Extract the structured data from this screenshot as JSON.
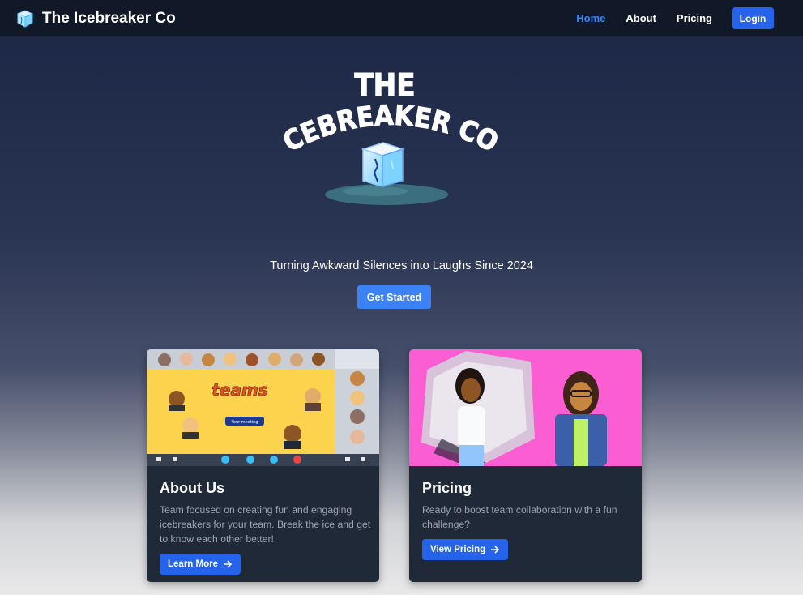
{
  "nav": {
    "brand": "The Icebreaker Co",
    "links": [
      {
        "label": "Home",
        "active": true
      },
      {
        "label": "About",
        "active": false
      },
      {
        "label": "Pricing",
        "active": false
      }
    ],
    "login_label": "Login"
  },
  "hero": {
    "logo_line1": "THE",
    "logo_line2": "ICEBREAKER CO.",
    "tagline": "Turning Awkward Silences into Laughs Since 2024",
    "cta_label": "Get Started"
  },
  "cards": [
    {
      "title": "About Us",
      "text": "Team focused on creating fun and engaging icebreakers for your team. Break the ice and get to know each other better!",
      "button_label": "Learn More",
      "image_caption": "teams",
      "image_button": "Your meeting"
    },
    {
      "title": "Pricing",
      "text": "Ready to boost team collaboration with a fun challenge?",
      "button_label": "View Pricing"
    }
  ],
  "colors": {
    "nav_bg": "#111827",
    "accent": "#3b82f6",
    "button": "#2563eb",
    "card_bg": "#1f2937",
    "teams_bg": "#fcd34d",
    "pricing_bg": "#fb5dd3"
  }
}
